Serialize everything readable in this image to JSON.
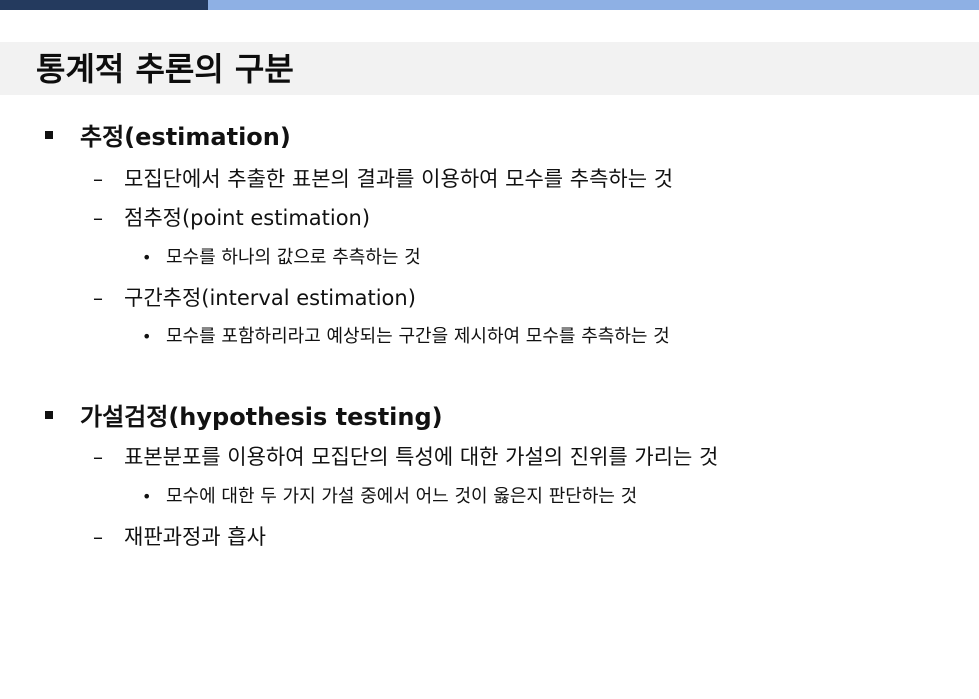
{
  "slide": {
    "title": "통계적 추론의 구분",
    "section1": {
      "heading": "추정(estimation)",
      "items": [
        "모집단에서 추출한 표본의 결과를 이용하여 모수를 추측하는 것",
        "점추정(point estimation)",
        "모수를 하나의 값으로 추측하는 것",
        "구간추정(interval estimation)",
        "모수를 포함하리라고 예상되는 구간을 제시하여 모수를 추측하는 것"
      ]
    },
    "section2": {
      "heading": "가설검정(hypothesis testing)",
      "items": [
        "표본분포를 이용하여 모집단의 특성에 대한 가설의 진위를 가리는 것",
        "모수에 대한 두 가지 가설 중에서 어느 것이 옳은지 판단하는 것",
        "재판과정과 흡사"
      ]
    },
    "markers": {
      "level1": "■",
      "level2": "–",
      "level3": "•"
    },
    "colors": {
      "top_bar_dark": "#243a5e",
      "top_bar_light": "#8eb0e4",
      "title_band": "#f2f2f2"
    }
  }
}
